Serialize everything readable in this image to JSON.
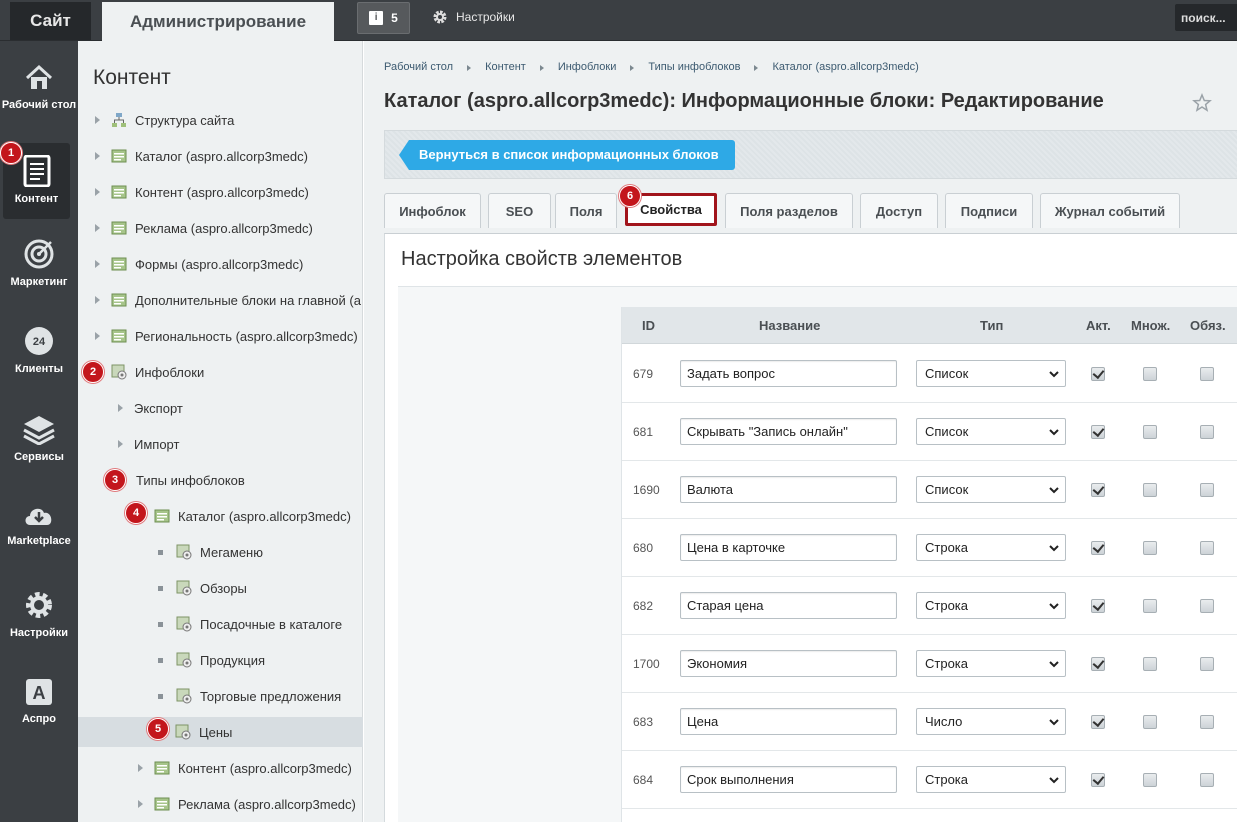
{
  "topbar": {
    "site_label": "Сайт",
    "admin_label": "Администрирование",
    "notifications_count": "5",
    "settings_label": "Настройки",
    "search_placeholder": "поиск..."
  },
  "iconbar": {
    "items": [
      {
        "label": "Рабочий стол",
        "icon": "house-icon"
      },
      {
        "label": "Контент",
        "icon": "document-icon"
      },
      {
        "label": "Маркетинг",
        "icon": "target-icon"
      },
      {
        "label": "Клиенты",
        "icon": "clients-24-icon",
        "icon_text": "24"
      },
      {
        "label": "Сервисы",
        "icon": "layers-icon"
      },
      {
        "label": "Marketplace",
        "icon": "cloud-download-icon"
      },
      {
        "label": "Настройки",
        "icon": "gear-icon"
      },
      {
        "label": "Аспро",
        "icon": "letter-a-icon",
        "icon_text": "A"
      }
    ]
  },
  "tree": {
    "title": "Контент",
    "items": [
      {
        "label": "Структура сайта"
      },
      {
        "label": "Каталог (aspro.allcorp3medc)"
      },
      {
        "label": "Контент (aspro.allcorp3medc)"
      },
      {
        "label": "Реклама (aspro.allcorp3medc)"
      },
      {
        "label": "Формы (aspro.allcorp3medc)"
      },
      {
        "label": "Дополнительные блоки на главной (a"
      },
      {
        "label": "Региональность (aspro.allcorp3medc)"
      },
      {
        "label": "Инфоблоки"
      },
      {
        "label": "Экспорт"
      },
      {
        "label": "Импорт"
      },
      {
        "label": "Типы инфоблоков"
      },
      {
        "label": "Каталог (aspro.allcorp3medc)"
      },
      {
        "label": "Мегаменю"
      },
      {
        "label": "Обзоры"
      },
      {
        "label": "Посадочные в каталоге"
      },
      {
        "label": "Продукция"
      },
      {
        "label": "Торговые предложения"
      },
      {
        "label": "Цены"
      },
      {
        "label": "Контент (aspro.allcorp3medc)"
      },
      {
        "label": "Реклама (aspro.allcorp3medc)"
      }
    ]
  },
  "badges": [
    "1",
    "2",
    "3",
    "4",
    "5",
    "6"
  ],
  "breadcrumb": [
    "Рабочий стол",
    "Контент",
    "Инфоблоки",
    "Типы инфоблоков",
    "Каталог (aspro.allcorp3medc)"
  ],
  "page_title": "Каталог (aspro.allcorp3medc): Информационные блоки: Редактирование",
  "toolbar": {
    "back_label": "Вернуться в список информационных блоков"
  },
  "tabs": [
    "Инфоблок",
    "SEO",
    "Поля",
    "Свойства",
    "Поля разделов",
    "Доступ",
    "Подписи",
    "Журнал событий"
  ],
  "active_tab": "Свойства",
  "panel": {
    "title": "Настройка свойств элементов",
    "columns": {
      "id": "ID",
      "name": "Название",
      "type": "Тип",
      "active": "Акт.",
      "multiple": "Множ.",
      "required": "Обяз."
    },
    "rows": [
      {
        "id": "679",
        "name": "Задать вопрос",
        "type": "Список",
        "active": true,
        "multiple": false,
        "required": false
      },
      {
        "id": "681",
        "name": "Скрывать \"Запись онлайн\"",
        "type": "Список",
        "active": true,
        "multiple": false,
        "required": false
      },
      {
        "id": "1690",
        "name": "Валюта",
        "type": "Список",
        "active": true,
        "multiple": false,
        "required": false
      },
      {
        "id": "680",
        "name": "Цена в карточке",
        "type": "Строка",
        "active": true,
        "multiple": false,
        "required": false
      },
      {
        "id": "682",
        "name": "Старая цена",
        "type": "Строка",
        "active": true,
        "multiple": false,
        "required": false
      },
      {
        "id": "1700",
        "name": "Экономия",
        "type": "Строка",
        "active": true,
        "multiple": false,
        "required": false
      },
      {
        "id": "683",
        "name": "Цена",
        "type": "Число",
        "active": true,
        "multiple": false,
        "required": false
      },
      {
        "id": "684",
        "name": "Срок выполнения",
        "type": "Строка",
        "active": true,
        "multiple": false,
        "required": false
      }
    ]
  },
  "colors": {
    "topbar": "#3b3f43",
    "accent_button": "#2ea9e6",
    "badge": "#c3161c",
    "active_tab_border": "#a1141b"
  }
}
